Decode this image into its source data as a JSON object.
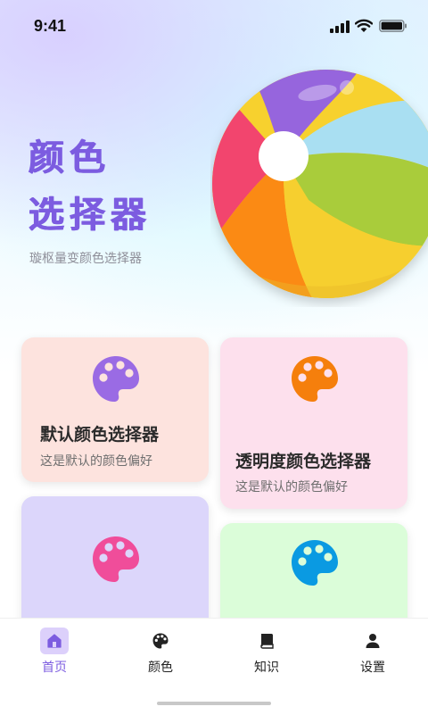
{
  "status_bar": {
    "time": "9:41",
    "icons": [
      "signal-icon",
      "wifi-icon",
      "battery-icon"
    ]
  },
  "hero": {
    "title_line1": "颜色",
    "title_line2": "选择器",
    "subtitle": "璇枢量变颜色选择器",
    "title_color": "#7c5ce0",
    "illustration": "beach-ball"
  },
  "cards": [
    {
      "title": "默认颜色选择器",
      "description": "这是默认的颜色偏好",
      "bg_color": "#fde3de",
      "icon": "palette-icon",
      "icon_color": "#9a6be4"
    },
    {
      "title": "透明度颜色选择器",
      "description": "这是默认的颜色偏好",
      "bg_color": "#fde0ed",
      "icon": "palette-icon",
      "icon_color": "#f57f0c"
    },
    {
      "title": "",
      "description": "",
      "bg_color": "#dcd6fb",
      "icon": "palette-icon",
      "icon_color": "#f04d9a"
    },
    {
      "title": "",
      "description": "",
      "bg_color": "#dbfdd9",
      "icon": "palette-icon",
      "icon_color": "#0a9ae2"
    }
  ],
  "tab_bar": {
    "active_color": "#7c5ce0",
    "tabs": [
      {
        "label": "首页",
        "icon": "home-icon",
        "active": true
      },
      {
        "label": "颜色",
        "icon": "palette-icon",
        "active": false
      },
      {
        "label": "知识",
        "icon": "book-icon",
        "active": false
      },
      {
        "label": "设置",
        "icon": "user-icon",
        "active": false
      }
    ]
  }
}
